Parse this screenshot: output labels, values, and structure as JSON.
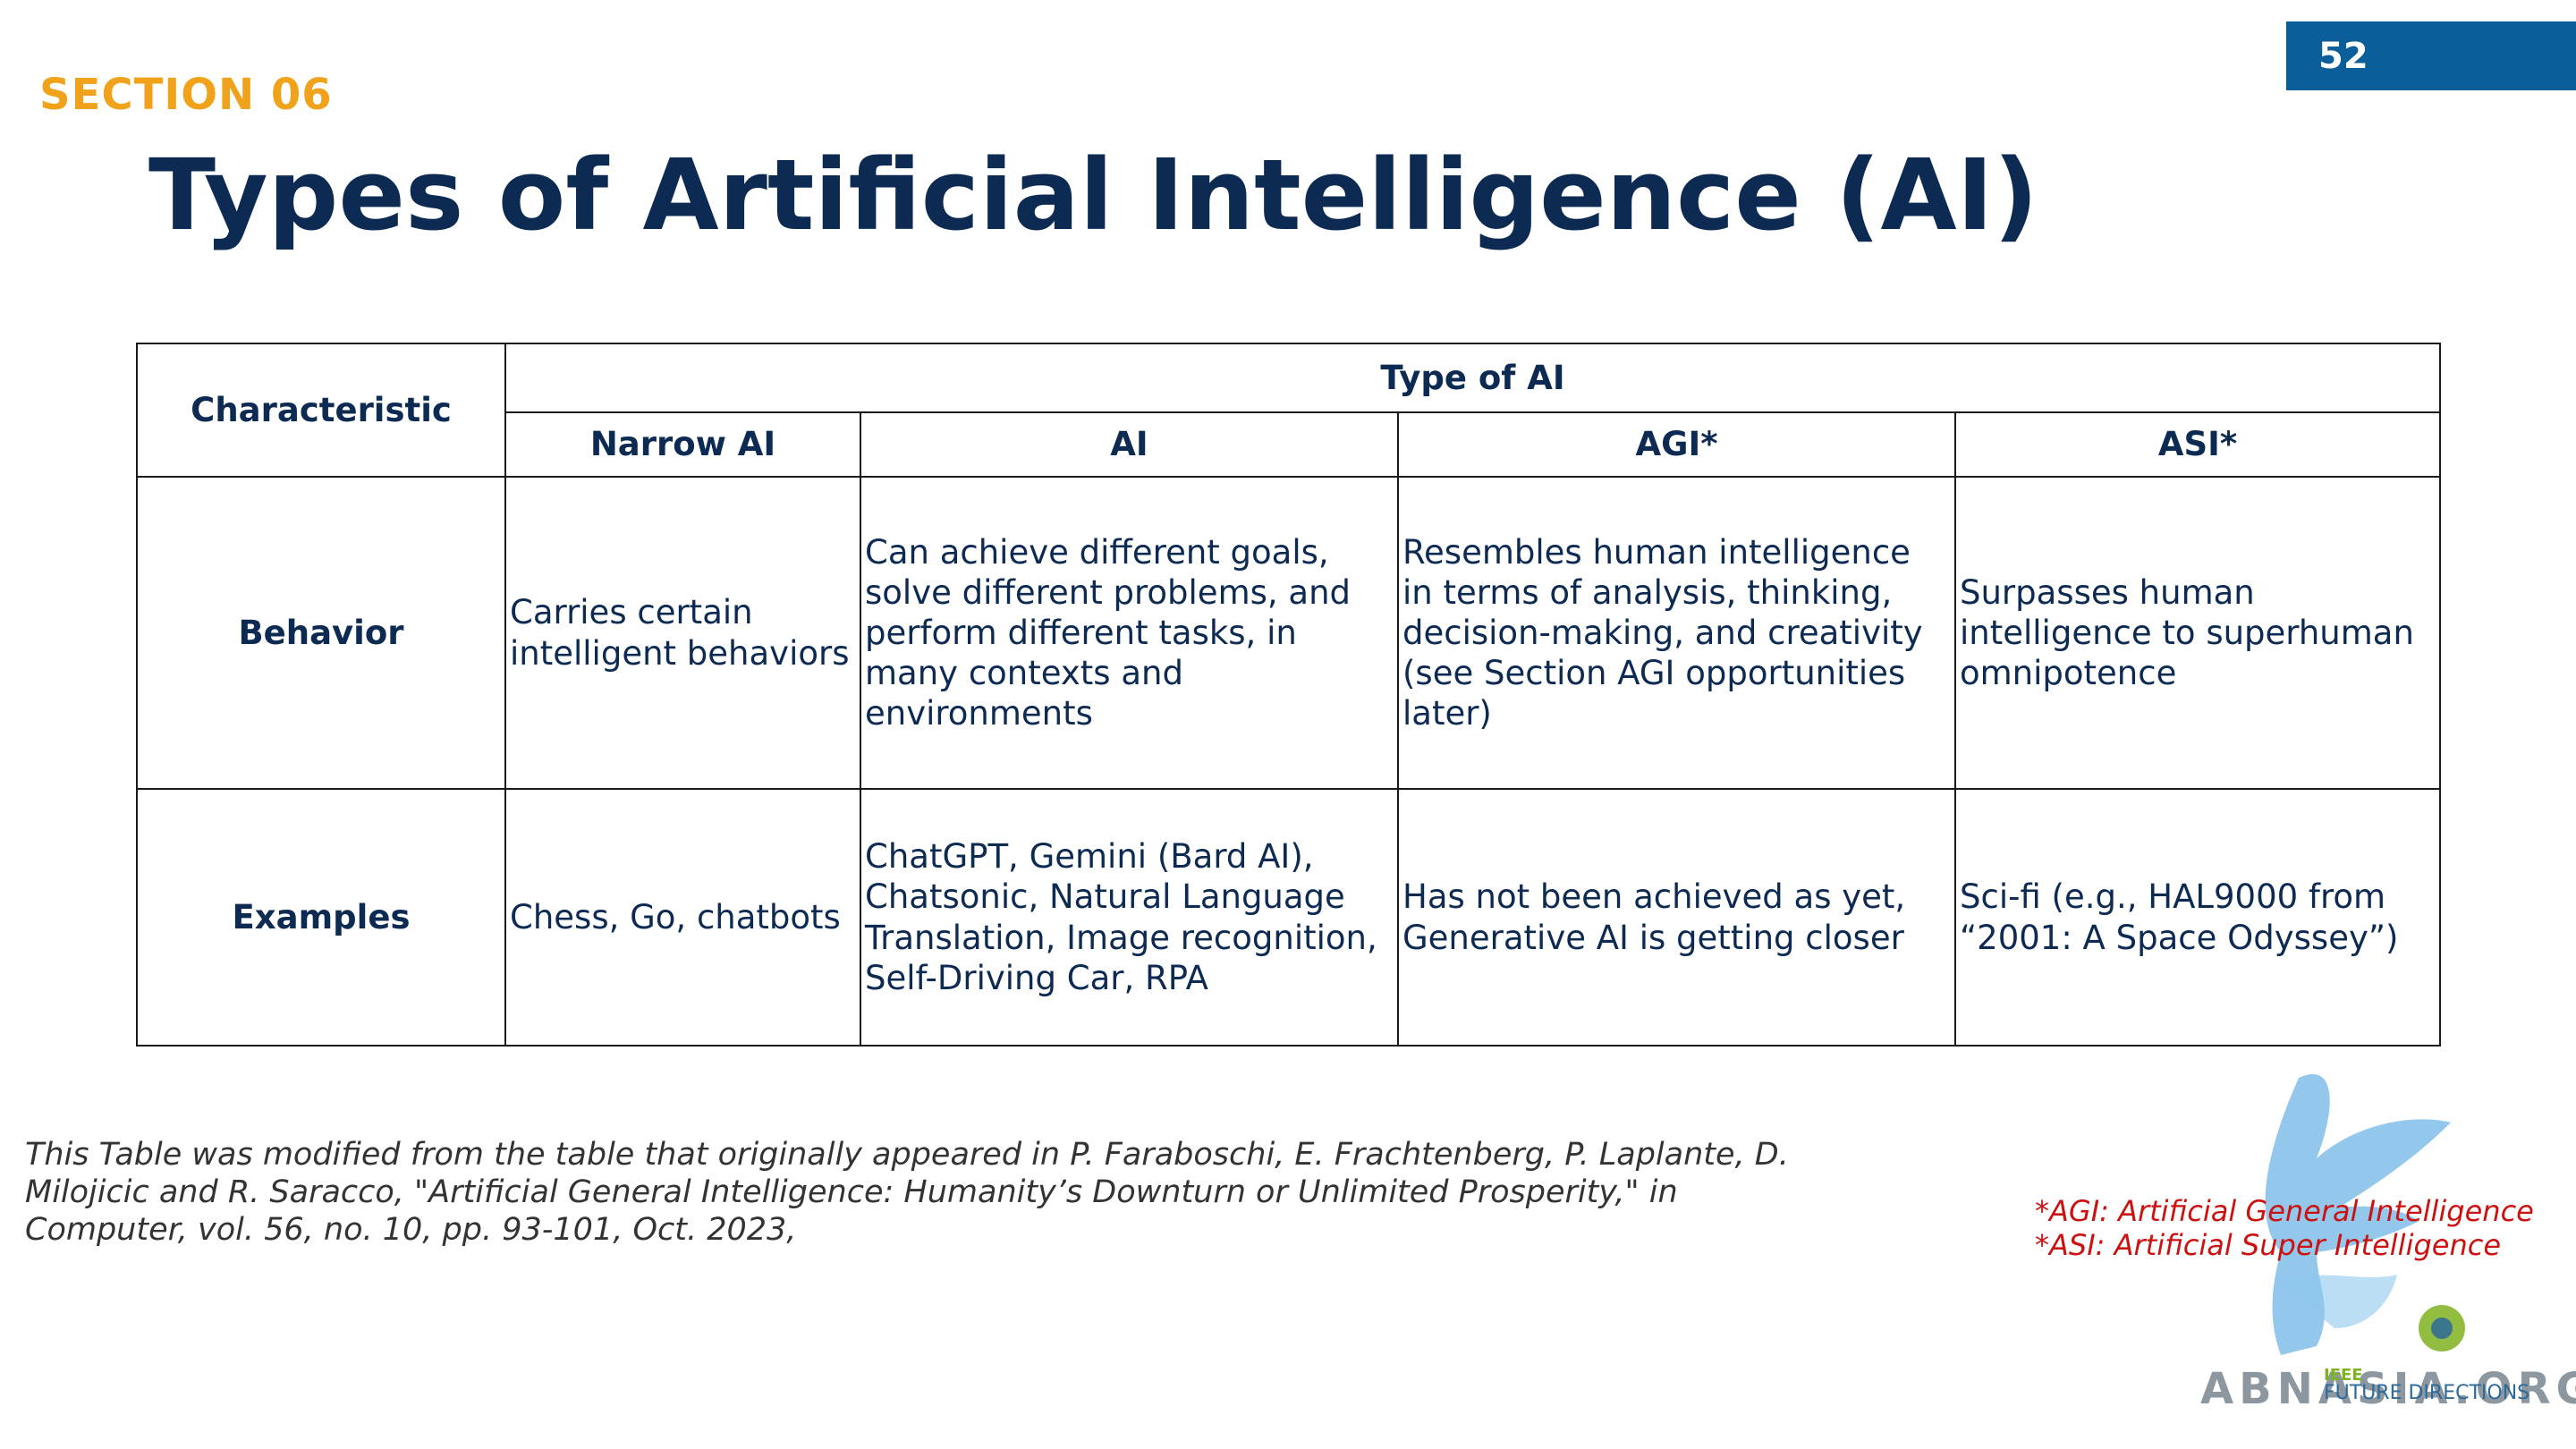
{
  "page_number": "52",
  "section_label": "SECTION 06",
  "title": "Types of Artificial Intelligence (AI)",
  "table": {
    "characteristic_header": "Characteristic",
    "type_header": "Type of AI",
    "columns": [
      "Narrow AI",
      "AI",
      "AGI*",
      "ASI*"
    ],
    "rows": [
      {
        "label": "Behavior",
        "cells": [
          "Carries certain intelligent behaviors",
          "Can achieve different goals, solve different problems, and perform different tasks, in many contexts and environments",
          "Resembles human intelligence in terms of analysis, thinking, decision-making, and creativity (see Section AGI opportunities later)",
          "Surpasses human intelligence to superhuman omnipotence"
        ]
      },
      {
        "label": "Examples",
        "cells": [
          "Chess, Go, chatbots",
          "ChatGPT, Gemini (Bard AI), Chatsonic, Natural Language Translation, Image recognition, Self-Driving Car, RPA",
          "Has not been achieved as yet, Generative AI is getting closer",
          "Sci-fi  (e.g., HAL9000 from “2001: A Space Odyssey”)"
        ]
      }
    ]
  },
  "footnote": "This Table was modified from the table that originally appeared in P. Faraboschi, E. Frachtenberg, P. Laplante, D. Milojicic and R. Saracco, \"Artificial General Intelligence: Humanity’s Downturn or Unlimited Prosperity,\" in Computer, vol. 56, no. 10, pp. 93-101, Oct. 2023,",
  "abbreviations": [
    "*AGI: Artificial General Intelligence",
    "*ASI: Artificial Super Intelligence"
  ],
  "logo": {
    "small_text": "IEEE",
    "caption": "FUTURE DIRECTIONS",
    "watermark": "ABNASIA.ORG"
  },
  "colors": {
    "accent_orange": "#f0a21a",
    "title_navy": "#0c2a52",
    "badge_blue": "#0a5e9a",
    "note_red": "#cc1111",
    "logo_light_blue": "#6fb6e6"
  }
}
